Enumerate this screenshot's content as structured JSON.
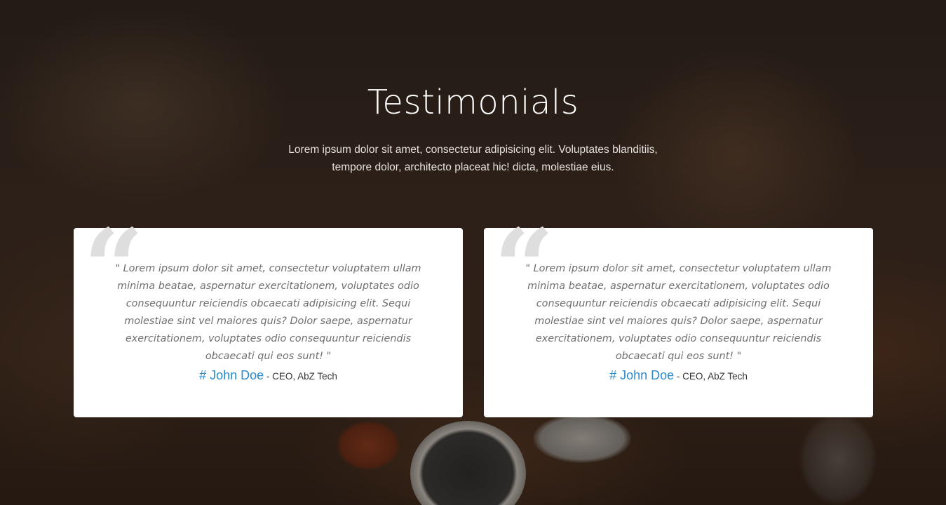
{
  "section": {
    "title": "Testimonials",
    "subtitle_line1": "Lorem ipsum dolor sit amet, consectetur adipisicing elit. Voluptates blanditiis,",
    "subtitle_line2": "tempore dolor, architecto placeat hic! dicta, molestiae eius."
  },
  "testimonials": [
    {
      "quote": "\" Lorem ipsum dolor sit amet, consectetur voluptatem ullam minima beatae, aspernatur exercitationem, voluptates odio consequuntur reiciendis obcaecati adipisicing elit. Sequi molestiae sint vel maiores quis? Dolor saepe, aspernatur exercitationem, voluptates odio consequuntur reiciendis obcaecati qui eos sunt! \"",
      "name": "# John Doe",
      "role": " - CEO, AbZ Tech"
    },
    {
      "quote": "\" Lorem ipsum dolor sit amet, consectetur voluptatem ullam minima beatae, aspernatur exercitationem, voluptates odio consequuntur reiciendis obcaecati adipisicing elit. Sequi molestiae sint vel maiores quis? Dolor saepe, aspernatur exercitationem, voluptates odio consequuntur reiciendis obcaecati qui eos sunt! \"",
      "name": "# John Doe",
      "role": " - CEO, AbZ Tech"
    }
  ],
  "icons": {
    "quote_mark": "“"
  },
  "colors": {
    "accent": "#2a89c9",
    "card_bg": "#ffffff",
    "quote_text": "#6f6f6f"
  }
}
